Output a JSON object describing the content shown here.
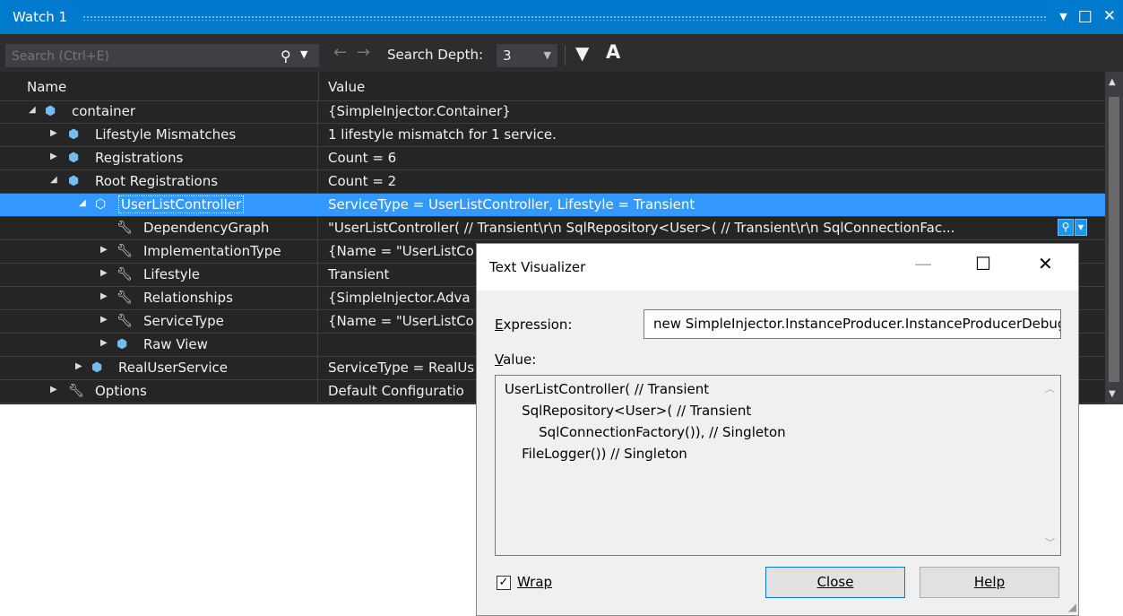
{
  "watch": {
    "title": "Watch 1",
    "search_placeholder": "Search (Ctrl+E)",
    "search_depth_label": "Search Depth:",
    "search_depth_value": "3",
    "columns": {
      "name": "Name",
      "value": "Value"
    }
  },
  "rows": [
    {
      "name": "container",
      "value": "{SimpleInjector.Container}"
    },
    {
      "name": "Lifestyle Mismatches",
      "value": "1 lifestyle mismatch for 1 service."
    },
    {
      "name": "Registrations",
      "value": "Count = 6"
    },
    {
      "name": "Root Registrations",
      "value": "Count = 2"
    },
    {
      "name": "UserListController",
      "value": "ServiceType = UserListController, Lifestyle = Transient"
    },
    {
      "name": "DependencyGraph",
      "value": "\"UserListController( // Transient\\r\\n    SqlRepository<User>( // Transient\\r\\n        SqlConnectionFac..."
    },
    {
      "name": "ImplementationType",
      "value": "{Name = \"UserListCo"
    },
    {
      "name": "Lifestyle",
      "value": "Transient"
    },
    {
      "name": "Relationships",
      "value": "{SimpleInjector.Adva"
    },
    {
      "name": "ServiceType",
      "value": "{Name = \"UserListCo"
    },
    {
      "name": "Raw View",
      "value": ""
    },
    {
      "name": "RealUserService",
      "value": "ServiceType = RealUs"
    },
    {
      "name": "Options",
      "value": "Default Configuratio"
    }
  ],
  "dialog": {
    "title": "Text Visualizer",
    "expression_label": "Expression:",
    "expression_value": "new SimpleInjector.InstanceProducer.InstanceProducerDebugView(...)",
    "value_label": "Value:",
    "value_lines": [
      "UserListController( // Transient",
      "    SqlRepository<User>( // Transient",
      "        SqlConnectionFactory()), // Singleton",
      "    FileLogger()) // Singleton"
    ],
    "wrap_label": "Wrap",
    "wrap_checked": true,
    "close_label": "Close",
    "help_label": "Help"
  },
  "colors": {
    "title_bar": "#007acc",
    "background": "#252526",
    "selection": "#3399ff",
    "icon_cube": "#75bdf0"
  }
}
